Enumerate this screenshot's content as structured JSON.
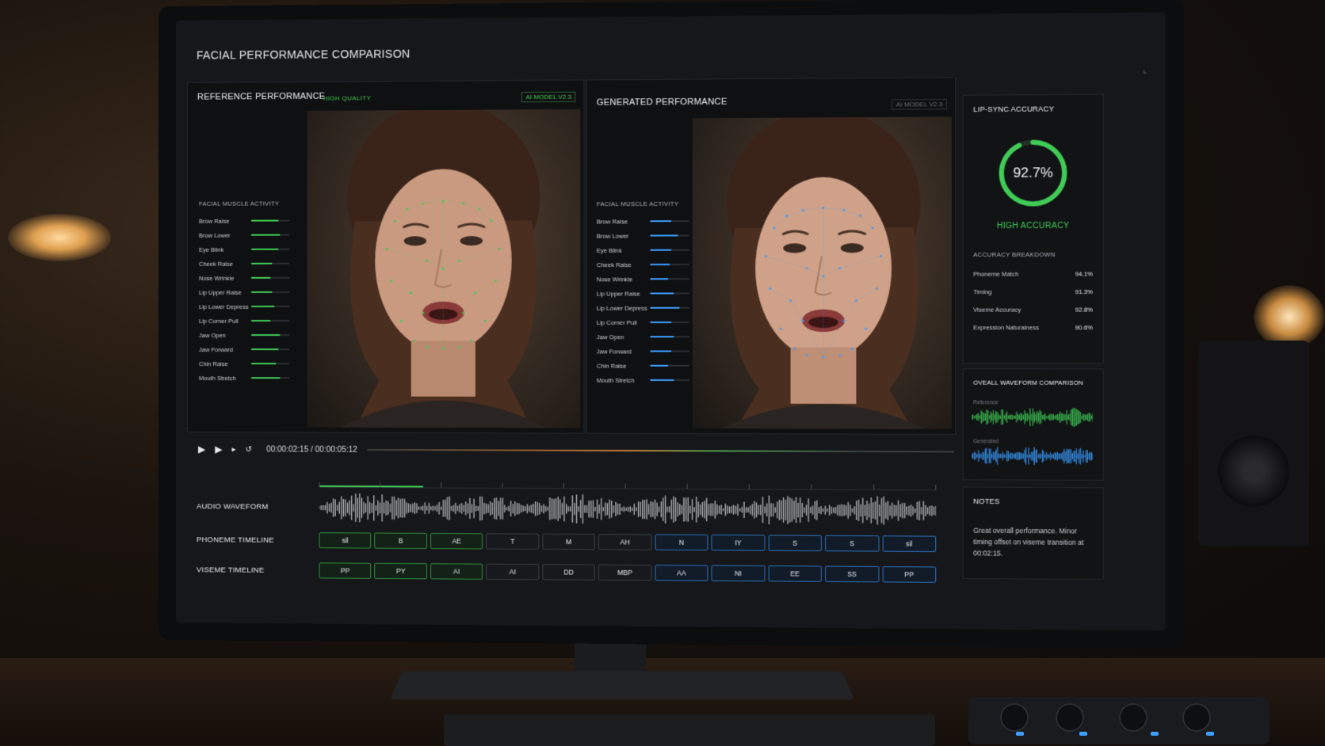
{
  "app": {
    "title": "FACIAL PERFORMANCE COMPARISON"
  },
  "reference": {
    "title": "REFERENCE PERFORMANCE",
    "quality_tag": "HIGH QUALITY",
    "model_tag": "AI MODEL V2.3",
    "muscle_title": "FACIAL MUSCLE ACTIVITY",
    "muscles": [
      {
        "label": "Brow Raise",
        "level": 0.7
      },
      {
        "label": "Brow Lower",
        "level": 0.75
      },
      {
        "label": "Eye Blink",
        "level": 0.7
      },
      {
        "label": "Cheek Raise",
        "level": 0.55
      },
      {
        "label": "Nose Wrinkle",
        "level": 0.5
      },
      {
        "label": "Lip Upper Raise",
        "level": 0.55
      },
      {
        "label": "Lip Lower Depress",
        "level": 0.6
      },
      {
        "label": "Lip Corner Pull",
        "level": 0.5
      },
      {
        "label": "Jaw Open",
        "level": 0.75
      },
      {
        "label": "Jaw Forward",
        "level": 0.7
      },
      {
        "label": "Chin Raise",
        "level": 0.65
      },
      {
        "label": "Mouth Stretch",
        "level": 0.75
      }
    ]
  },
  "generated": {
    "title": "GENERATED PERFORMANCE",
    "model_tag": "AI MODEL V2.3",
    "muscle_title": "FACIAL MUSCLE ACTIVITY",
    "muscles": [
      {
        "label": "Brow Raise",
        "level": 0.55
      },
      {
        "label": "Brow Lower",
        "level": 0.7
      },
      {
        "label": "Eye Blink",
        "level": 0.55
      },
      {
        "label": "Cheek Raise",
        "level": 0.5
      },
      {
        "label": "Nose Wrinkle",
        "level": 0.45
      },
      {
        "label": "Lip Upper Raise",
        "level": 0.6
      },
      {
        "label": "Lip Lower Depress",
        "level": 0.75
      },
      {
        "label": "Lip Corner Pull",
        "level": 0.55
      },
      {
        "label": "Jaw Open",
        "level": 0.6
      },
      {
        "label": "Jaw Forward",
        "level": 0.55
      },
      {
        "label": "Chin Raise",
        "level": 0.45
      },
      {
        "label": "Mouth Stretch",
        "level": 0.6
      }
    ]
  },
  "lipsync": {
    "title": "LIP-SYNC ACCURACY",
    "value_text": "92.7%",
    "value": 0.927,
    "label": "HIGH ACCURACY",
    "breakdown_title": "ACCURACY BREAKDOWN",
    "breakdown": [
      {
        "label": "Phoneme Match",
        "value": "94.1%"
      },
      {
        "label": "Timing",
        "value": "91.3%"
      },
      {
        "label": "Viseme Accuracy",
        "value": "92.8%"
      },
      {
        "label": "Expression Naturalness",
        "value": "90.6%"
      }
    ]
  },
  "waveform_compare": {
    "title": "OVEALL WAVEFORM COMPARISON",
    "reference_label": "Reference",
    "generated_label": "Generated"
  },
  "notes": {
    "title": "NOTES",
    "text": "Great overall performance. Minor timing offset on viseme transition at 00:02:15."
  },
  "transport": {
    "timecode": "00:00:02:15 / 00:00:05:12"
  },
  "tracks": {
    "audio_label": "AUDIO WAVEFORM",
    "phoneme_label": "PHONEME TIMELINE",
    "viseme_label": "VISEME TIMELINE",
    "phonemes": [
      "sil",
      "B",
      "AE",
      "T",
      "M",
      "AH",
      "N",
      "IY",
      "S",
      "S",
      "sil"
    ],
    "visemes": [
      "PP",
      "PY",
      "AI",
      "AI",
      "DD",
      "MBP",
      "AA",
      "NI",
      "EE",
      "SS",
      "PP"
    ]
  },
  "colors": {
    "accent_green": "#3fcb55",
    "accent_blue": "#3b9cff"
  }
}
